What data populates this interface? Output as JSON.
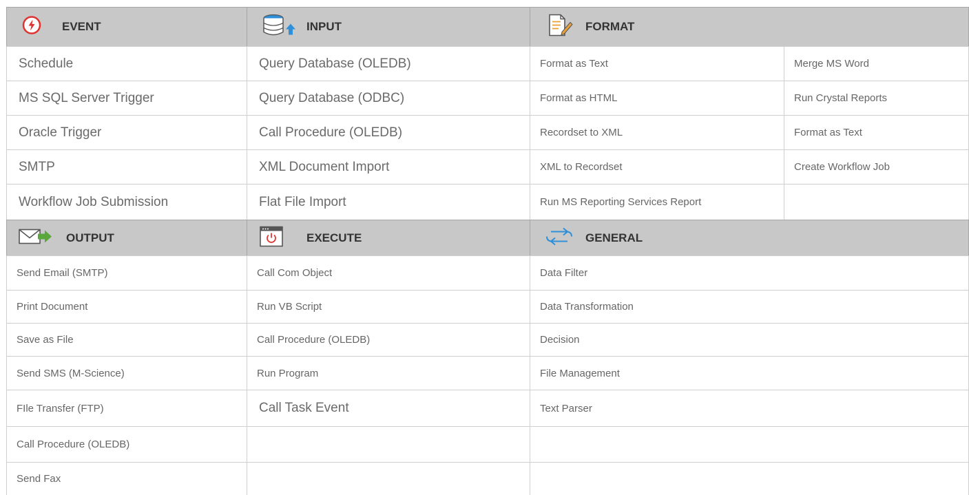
{
  "sections": {
    "event": {
      "title": "EVENT",
      "icon": "lightning-icon",
      "items": [
        "Schedule",
        "MS SQL Server Trigger",
        "Oracle Trigger",
        "SMTP",
        "Workflow Job Submission"
      ]
    },
    "input": {
      "title": "INPUT",
      "icon": "database-upload-icon",
      "items": [
        "Query Database (OLEDB)",
        "Query Database (ODBC)",
        "Call Procedure (OLEDB)",
        "XML Document Import",
        "Flat File Import"
      ]
    },
    "format": {
      "title": "FORMAT",
      "icon": "document-edit-icon",
      "items_left": [
        "Format as Text",
        "Format as HTML",
        "Recordset to XML",
        "XML to Recordset",
        "Run MS Reporting Services Report"
      ],
      "items_right": [
        "Merge MS Word",
        "Run Crystal Reports",
        "Format as Text",
        "Create Workflow Job",
        ""
      ]
    },
    "output": {
      "title": "OUTPUT",
      "icon": "envelope-send-icon",
      "items": [
        "Send Email (SMTP)",
        "Print Document",
        "Save as File",
        "Send SMS (M-Science)",
        "FIle Transfer (FTP)",
        "Call Procedure (OLEDB)",
        "Send Fax"
      ]
    },
    "execute": {
      "title": "EXECUTE",
      "icon": "power-window-icon",
      "items": [
        "Call Com Object",
        "Run VB Script",
        "Call Procedure (OLEDB)",
        "Run Program",
        "Call Task Event"
      ]
    },
    "general": {
      "title": "GENERAL",
      "icon": "sync-arrows-icon",
      "items": [
        "Data Filter",
        "Data Transformation",
        "Decision",
        "File Management",
        "Text Parser"
      ]
    }
  },
  "colors": {
    "header_bg": "#c8c8c8",
    "header_text": "#333333",
    "item_text": "#666666",
    "event_red": "#e0332f",
    "accent_blue": "#2f8fd8",
    "accent_green": "#5aa83c"
  }
}
